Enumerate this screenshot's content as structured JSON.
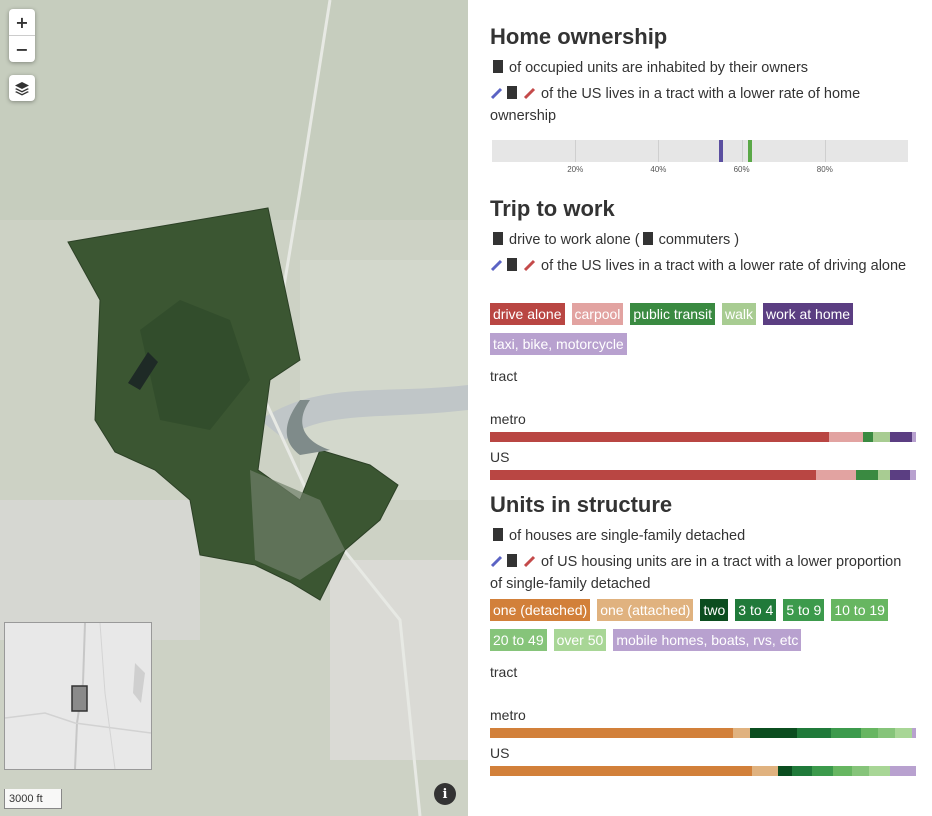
{
  "map": {
    "zoom_in": "+",
    "zoom_out": "−",
    "layers_icon": "layers-icon",
    "scale": "3000 ft",
    "info": "i"
  },
  "home": {
    "title": "Home ownership",
    "line1": "of occupied units are inhabited by their owners",
    "line2": "of the US lives in a tract with a lower rate of home ownership",
    "ticks": [
      "20%",
      "40%",
      "60%",
      "80%"
    ],
    "markers": [
      {
        "value": 55,
        "color": "#5b4fa0"
      },
      {
        "value": 62,
        "color": "#5aa847"
      }
    ]
  },
  "trip": {
    "title": "Trip to work",
    "line1a": "drive to work alone (",
    "line1b": "commuters )",
    "line2": "of the US lives in a tract with a lower rate of driving alone",
    "legend": [
      {
        "label": "drive alone",
        "color": "#b94643"
      },
      {
        "label": "carpool",
        "color": "#e2a3a1"
      },
      {
        "label": "public transit",
        "color": "#3a8a41"
      },
      {
        "label": "walk",
        "color": "#a8cc92"
      },
      {
        "label": "work at home",
        "color": "#5b3e82"
      },
      {
        "label": "taxi, bike, motorcycle",
        "color": "#b8a1cf"
      }
    ],
    "rows": [
      {
        "label": "tract",
        "values": []
      },
      {
        "label": "metro",
        "values": [
          79.5,
          8,
          2.5,
          4,
          5,
          1
        ]
      },
      {
        "label": "US",
        "values": [
          76.5,
          9.5,
          5,
          3,
          4.5,
          1.5
        ]
      }
    ]
  },
  "units": {
    "title": "Units in structure",
    "line1": "of houses are single-family detached",
    "line2": "of US housing units are in a tract with a lower proportion of single-family detached",
    "legend": [
      {
        "label": "one (detached)",
        "color": "#d2803a"
      },
      {
        "label": "one (attached)",
        "color": "#e0b27f"
      },
      {
        "label": "two",
        "color": "#0b4d1f"
      },
      {
        "label": "3 to 4",
        "color": "#207a3a"
      },
      {
        "label": "5 to 9",
        "color": "#3c9a4c"
      },
      {
        "label": "10 to 19",
        "color": "#67b661"
      },
      {
        "label": "20 to 49",
        "color": "#86c47a"
      },
      {
        "label": "over 50",
        "color": "#a8d696"
      },
      {
        "label": "mobile homes, boats, rvs, etc",
        "color": "#b8a1cf"
      }
    ],
    "rows": [
      {
        "label": "tract",
        "values": []
      },
      {
        "label": "metro",
        "values": [
          57,
          4,
          11,
          8,
          7,
          4,
          4,
          4,
          1
        ]
      },
      {
        "label": "US",
        "values": [
          61.5,
          6,
          3.5,
          4.5,
          5,
          4.5,
          4,
          5,
          6
        ]
      }
    ]
  }
}
